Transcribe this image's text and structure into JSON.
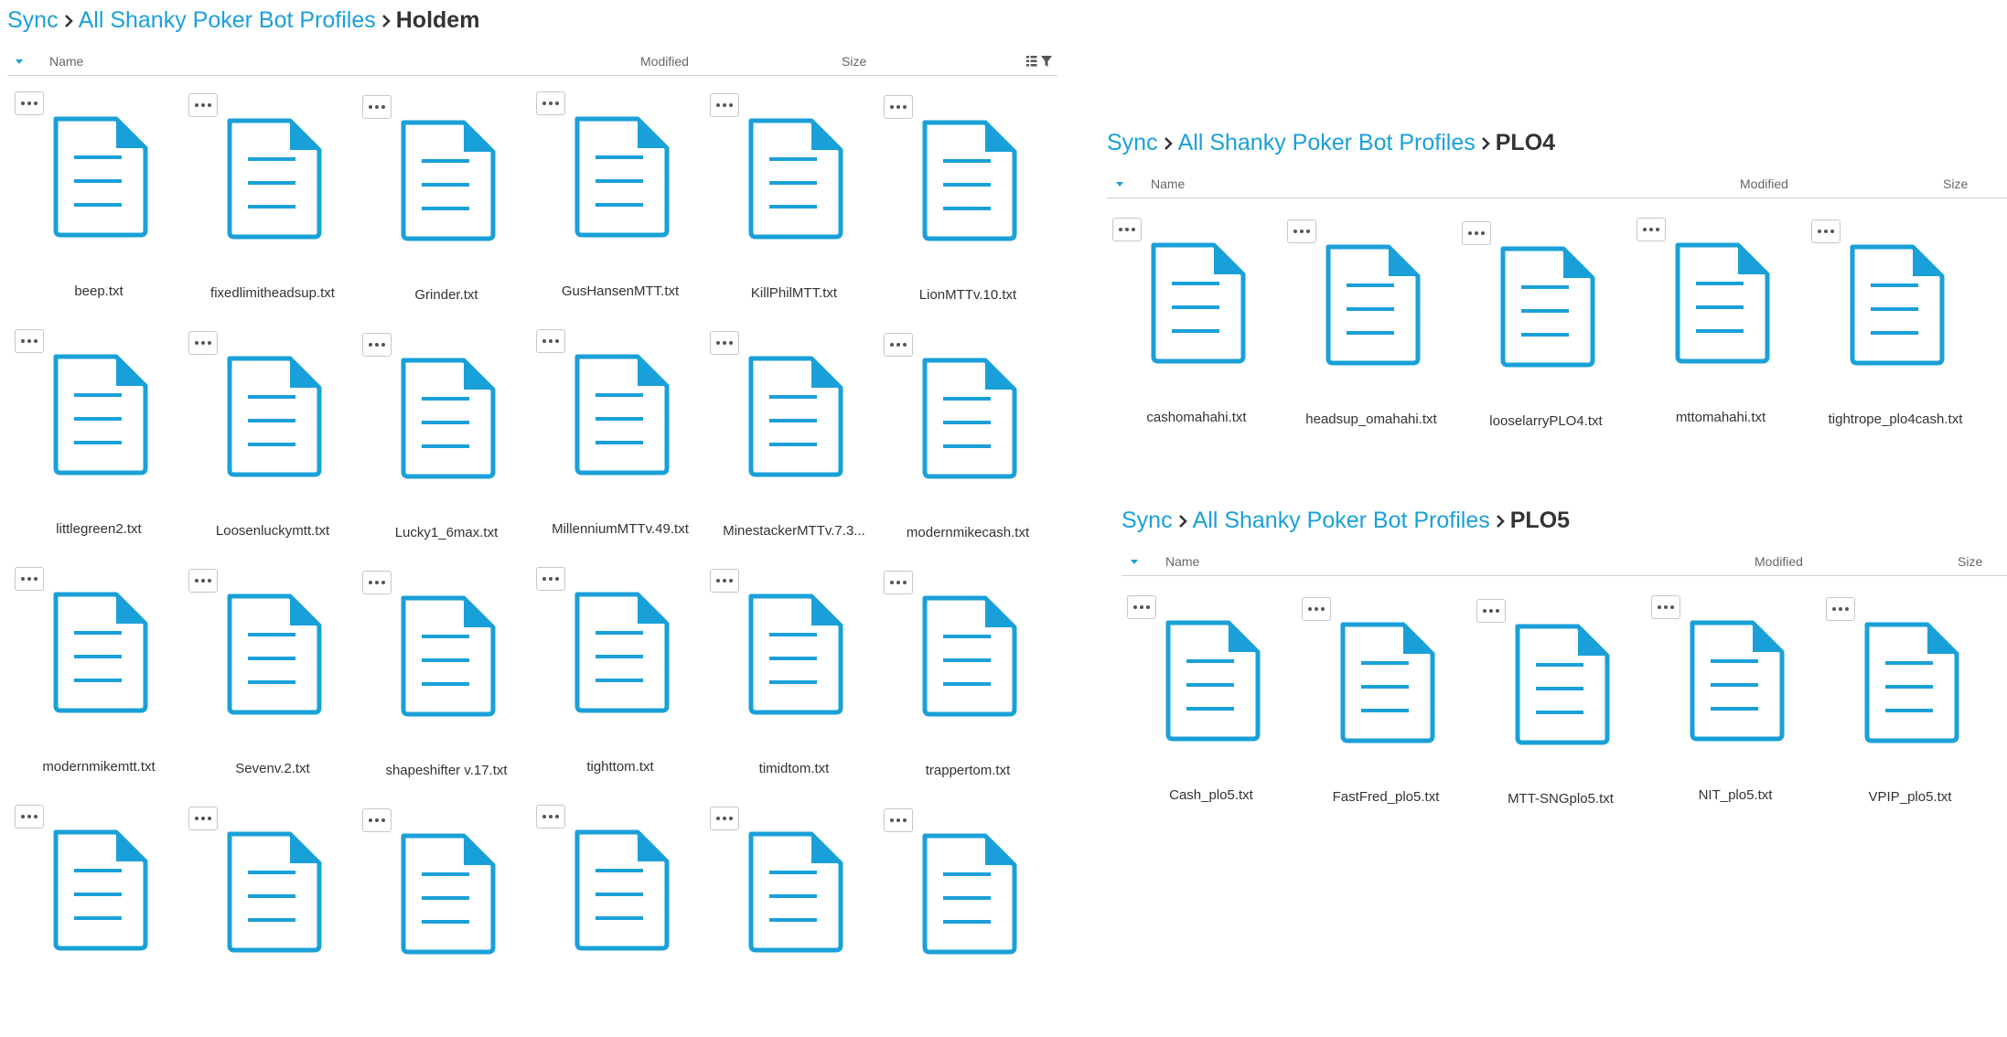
{
  "colors": {
    "accent": "#1aa0d8",
    "text": "#333333",
    "muted": "#666666",
    "divider": "#cfcfcf"
  },
  "icons": {
    "file": "document-icon",
    "more": "ellipsis-icon",
    "sort": "caret-down-icon",
    "separator": "chevron-right-icon",
    "list": "list-view-icon",
    "filter": "filter-icon"
  },
  "holdem": {
    "breadcrumb": {
      "root": "Sync",
      "parent": "All Shanky Poker Bot Profiles",
      "current": "Holdem"
    },
    "columns": {
      "name": "Name",
      "modified": "Modified",
      "size": "Size"
    },
    "files": [
      "beep.txt",
      "fixedlimitheadsup.txt",
      "Grinder.txt",
      "GusHansenMTT.txt",
      "KillPhilMTT.txt",
      "LionMTTv.10.txt",
      "littlegreen2.txt",
      "Loosenluckymtt.txt",
      "Lucky1_6max.txt",
      "MillenniumMTTv.49.txt",
      "MinestackerMTTv.7.3...",
      "modernmikecash.txt",
      "modernmikemtt.txt",
      "Sevenv.2.txt",
      "shapeshifter v.17.txt",
      "tighttom.txt",
      "timidtom.txt",
      "trappertom.txt",
      "",
      "",
      "",
      "",
      "",
      ""
    ]
  },
  "plo4": {
    "breadcrumb": {
      "root": "Sync",
      "parent": "All Shanky Poker Bot Profiles",
      "current": "PLO4"
    },
    "columns": {
      "name": "Name",
      "modified": "Modified",
      "size": "Size"
    },
    "files": [
      "cashomahahi.txt",
      "headsup_omahahi.txt",
      "looselarryPLO4.txt",
      "mttomahahi.txt",
      "tightrope_plo4cash.txt"
    ]
  },
  "plo5": {
    "breadcrumb": {
      "root": "Sync",
      "parent": "All Shanky Poker Bot Profiles",
      "current": "PLO5"
    },
    "columns": {
      "name": "Name",
      "modified": "Modified",
      "size": "Size"
    },
    "files": [
      "Cash_plo5.txt",
      "FastFred_plo5.txt",
      "MTT-SNGplo5.txt",
      "NIT_plo5.txt",
      "VPIP_plo5.txt"
    ]
  }
}
